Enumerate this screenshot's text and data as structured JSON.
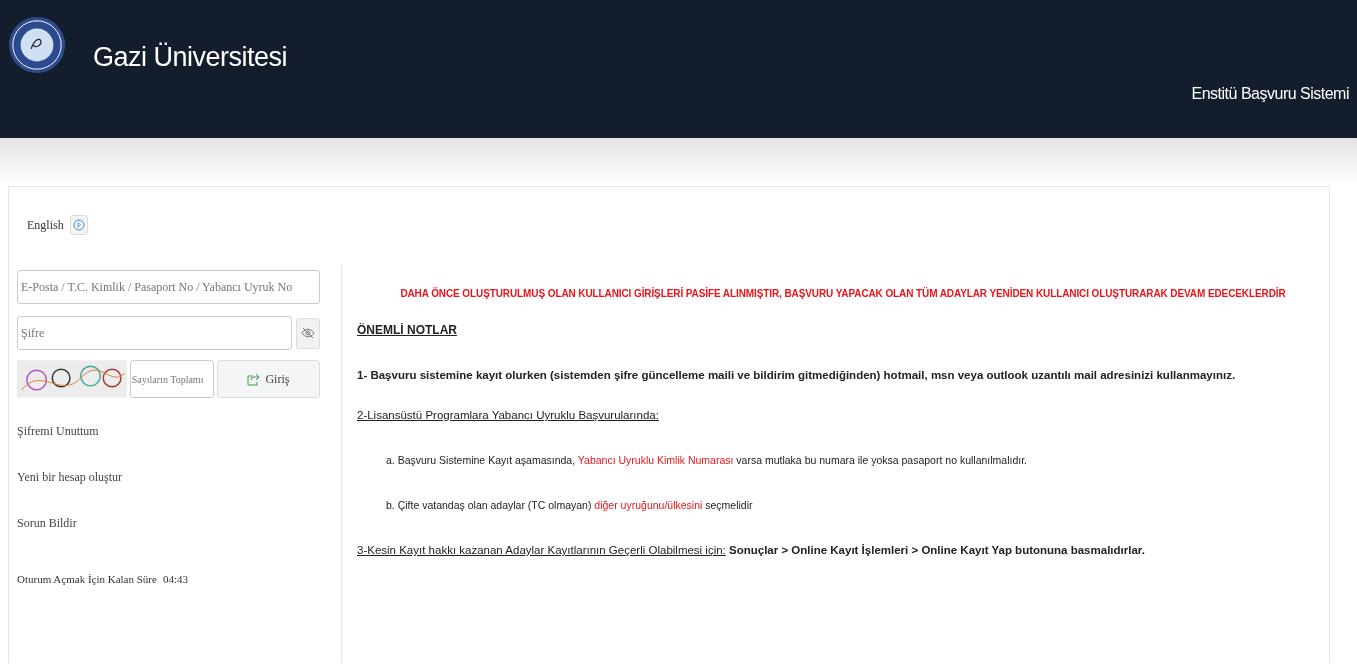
{
  "header": {
    "title": "Gazi Üniversitesi",
    "subtitle": "Enstitü Başvuru Sistemi"
  },
  "language": {
    "label": "English"
  },
  "login": {
    "username": {
      "placeholder": "E-Posta / T.C. Kimlik / Pasaport No / Yabancı Uyruk No"
    },
    "password": {
      "placeholder": "Şifre"
    },
    "captcha_field": {
      "placeholder": "Sayıların Toplamı"
    },
    "submit": "Giriş"
  },
  "links": [
    "Şifremi Unuttum",
    "Yeni bir hesap oluştur",
    "Sorun Bildir"
  ],
  "session": {
    "label": "Oturum Açmak İçin Kalan Süre",
    "time": "04:43"
  },
  "announcement": "DAHA ÖNCE OLUŞTURULMUŞ OLAN KULLANICI GİRİŞLERİ PASİFE ALINMIŞTIR, BAŞVURU YAPACAK OLAN TÜM ADAYLAR YENİDEN KULLANICI OLUŞTURARAK DEVAM EDECEKLERDİR",
  "notes_title": "ÖNEMLİ NOTLAR",
  "notes": [
    {
      "kind": "para",
      "parts": [
        {
          "kind": "bold",
          "text": "1- Başvuru sistemine kayıt olurken (sistemden şifre güncelleme maili ve bildirim gitmediğinden) hotmail, msn veya outlook uzantılı mail adresinizi kullanmayınız."
        }
      ]
    },
    {
      "kind": "heading",
      "parts": [
        {
          "kind": "underline",
          "text": "2-Lisansüstü Programlara Yabancı Uyruklu Başvurularında:"
        }
      ]
    },
    {
      "kind": "sub",
      "parts": [
        {
          "kind": "plain",
          "text": "a. Başvuru Sistemine Kayıt aşamasında, "
        },
        {
          "kind": "red",
          "text": "Yabancı Uyruklu Kimlik Numarası"
        },
        {
          "kind": "plain",
          "text": " varsa mutlaka bu numara ile yoksa pasaport no kullanılmalıdır."
        }
      ]
    },
    {
      "kind": "sub",
      "parts": [
        {
          "kind": "plain",
          "text": "b. Çifte vatandaş olan adaylar (TC olmayan) "
        },
        {
          "kind": "red",
          "text": "diğer uyruğunu/ülkesini"
        },
        {
          "kind": "plain",
          "text": " seçmelidir"
        }
      ]
    },
    {
      "kind": "para",
      "parts": [
        {
          "kind": "underline",
          "text": "3-Kesin Kayıt hakkı kazanan Adaylar Kayıtlarının Geçerli Olabilmesi için:"
        },
        {
          "kind": "bold",
          "text": " Sonuçlar > Online Kayıt İşlemleri > Online Kayıt Yap butonuna basmalıdırlar."
        }
      ]
    }
  ]
}
